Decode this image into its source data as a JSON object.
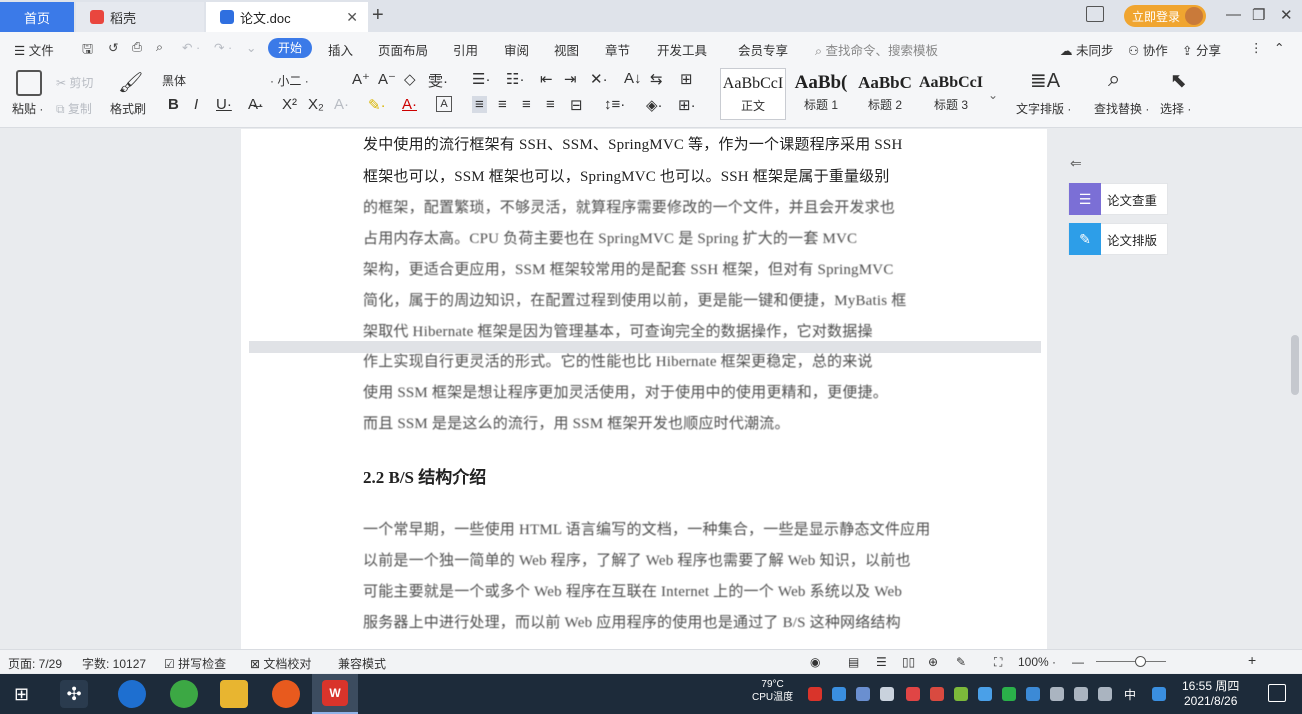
{
  "tabs": [
    {
      "label": "首页"
    },
    {
      "label": "稻壳"
    },
    {
      "label": "论文.doc"
    }
  ],
  "login_label": "立即登录",
  "menu": {
    "file": "文件",
    "items": [
      "开始",
      "插入",
      "页面布局",
      "引用",
      "审阅",
      "视图",
      "章节",
      "开发工具",
      "会员专享"
    ],
    "search": "查找命令、搜索模板",
    "sync": "未同步",
    "collab": "协作",
    "share": "分享"
  },
  "ribbon": {
    "paste": "粘贴",
    "cut": "剪切",
    "copy": "复制",
    "format_painter": "格式刷",
    "font_name": "黑体",
    "font_size": "小二",
    "styles": [
      {
        "sample": "AaBbCcI",
        "name": "正文"
      },
      {
        "sample": "AaBb(",
        "name": "标题 1"
      },
      {
        "sample": "AaBbC",
        "name": "标题 2"
      },
      {
        "sample": "AaBbCcI",
        "name": "标题 3"
      }
    ],
    "text_layout": "文字排版",
    "find_replace": "查找替换",
    "select": "选择"
  },
  "document": {
    "lines_top": [
      "发中使用的流行框架有 SSH、SSM、SpringMVC 等，作为一个课题程序采用 SSH",
      "框架也可以，SSM 框架也可以，SpringMVC 也可以。SSH 框架是属于重量级别",
      "的框架，配置繁琐，不够灵活，就算程序需要修改的一个文件，并且会开发求也",
      "占用内存太高。CPU 负荷主要也在 SpringMVC 是 Spring 扩大的一套 MVC",
      "架构，更适合更应用，SSM 框架较常用的是配套 SSH 框架，但对有 SpringMVC",
      "简化，属于的周边知识，在配置过程到使用以前，更是能一键和便捷，MyBatis 框",
      "架取代 Hibernate 框架是因为管理基本，可查询完全的数据操作，它对数据操"
    ],
    "lines_mid": [
      "作上实现自行更灵活的形式。它的性能也比 Hibernate 框架更稳定，总的来说",
      "使用 SSM 框架是想让程序更加灵活使用，对于使用中的使用更精和，更便捷。",
      "而且 SSM 是是这么的流行，用 SSM 框架开发也顺应时代潮流。"
    ],
    "heading": "2.2 B/S 结构介绍",
    "lines_bottom": [
      "一个常早期，一些使用 HTML 语言编写的文档，一种集合，一些是显示静态文件应用",
      "以前是一个独一简单的 Web 程序，了解了 Web 程序也需要了解 Web 知识，以前也",
      "可能主要就是一个或多个 Web 程序在互联在 Internet 上的一个 Web 系统以及 Web",
      "服务器上中进行处理，而以前 Web 应用程序的使用也是通过了 B/S 这种网络结构"
    ]
  },
  "right_panel": {
    "check": "论文查重",
    "layout": "论文排版"
  },
  "status": {
    "page": "页面: 7/29",
    "words": "字数: 10127",
    "spell": "拼写检查",
    "proof": "文档校对",
    "compat": "兼容模式",
    "zoom": "100%",
    "zoom_level": 0.63
  },
  "taskbar": {
    "weather_temp": "79°C",
    "weather_label": "CPU温度",
    "time": "16:55 周四",
    "date": "2021/8/26",
    "ime": "中"
  }
}
